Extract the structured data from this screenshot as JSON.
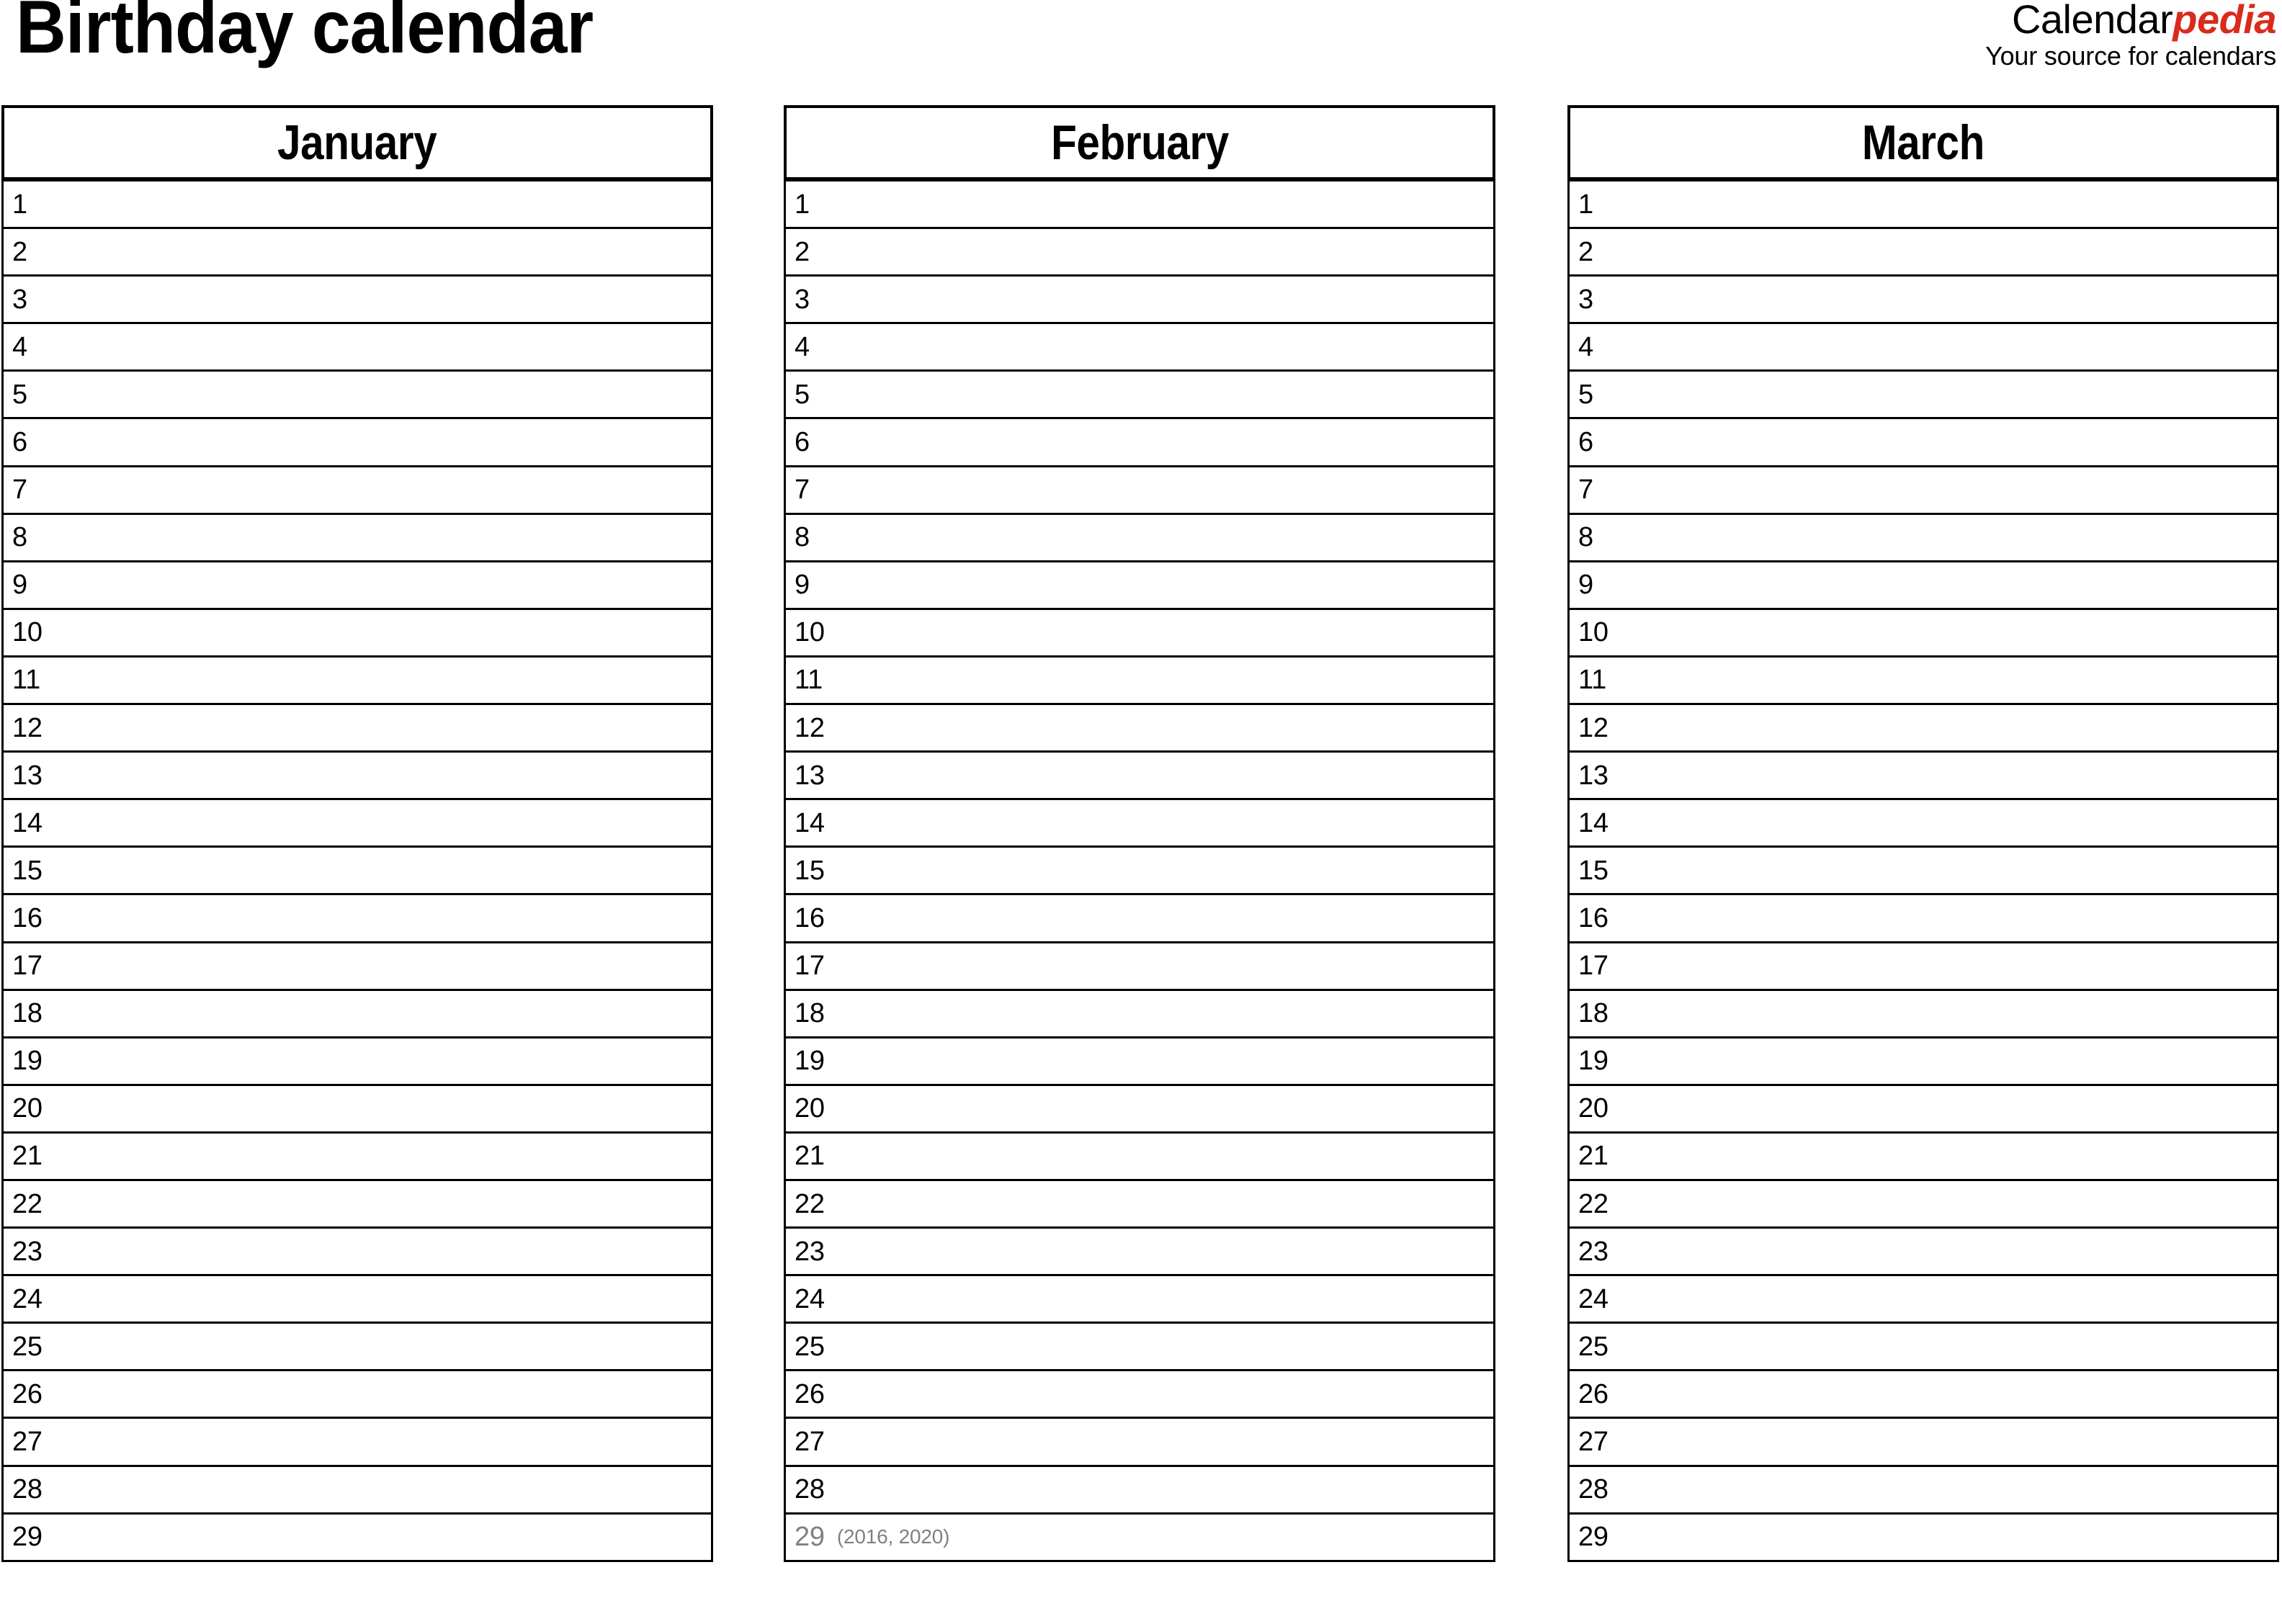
{
  "document": {
    "title": "Birthday calendar"
  },
  "brand": {
    "word1": "Calendar",
    "word2": "pedia",
    "tagline": "Your source for calendars",
    "accent_color": "#D92B1C"
  },
  "colors": {
    "border": "#000000",
    "text": "#000000",
    "muted": "#808080",
    "background": "#ffffff"
  },
  "months": [
    {
      "name": "January",
      "days": [
        {
          "num": "1"
        },
        {
          "num": "2"
        },
        {
          "num": "3"
        },
        {
          "num": "4"
        },
        {
          "num": "5"
        },
        {
          "num": "6"
        },
        {
          "num": "7"
        },
        {
          "num": "8"
        },
        {
          "num": "9"
        },
        {
          "num": "10"
        },
        {
          "num": "11"
        },
        {
          "num": "12"
        },
        {
          "num": "13"
        },
        {
          "num": "14"
        },
        {
          "num": "15"
        },
        {
          "num": "16"
        },
        {
          "num": "17"
        },
        {
          "num": "18"
        },
        {
          "num": "19"
        },
        {
          "num": "20"
        },
        {
          "num": "21"
        },
        {
          "num": "22"
        },
        {
          "num": "23"
        },
        {
          "num": "24"
        },
        {
          "num": "25"
        },
        {
          "num": "26"
        },
        {
          "num": "27"
        },
        {
          "num": "28"
        },
        {
          "num": "29"
        }
      ]
    },
    {
      "name": "February",
      "days": [
        {
          "num": "1"
        },
        {
          "num": "2"
        },
        {
          "num": "3"
        },
        {
          "num": "4"
        },
        {
          "num": "5"
        },
        {
          "num": "6"
        },
        {
          "num": "7"
        },
        {
          "num": "8"
        },
        {
          "num": "9"
        },
        {
          "num": "10"
        },
        {
          "num": "11"
        },
        {
          "num": "12"
        },
        {
          "num": "13"
        },
        {
          "num": "14"
        },
        {
          "num": "15"
        },
        {
          "num": "16"
        },
        {
          "num": "17"
        },
        {
          "num": "18"
        },
        {
          "num": "19"
        },
        {
          "num": "20"
        },
        {
          "num": "21"
        },
        {
          "num": "22"
        },
        {
          "num": "23"
        },
        {
          "num": "24"
        },
        {
          "num": "25"
        },
        {
          "num": "26"
        },
        {
          "num": "27"
        },
        {
          "num": "28"
        },
        {
          "num": "29",
          "note": "(2016, 2020)",
          "extra": true
        }
      ]
    },
    {
      "name": "March",
      "days": [
        {
          "num": "1"
        },
        {
          "num": "2"
        },
        {
          "num": "3"
        },
        {
          "num": "4"
        },
        {
          "num": "5"
        },
        {
          "num": "6"
        },
        {
          "num": "7"
        },
        {
          "num": "8"
        },
        {
          "num": "9"
        },
        {
          "num": "10"
        },
        {
          "num": "11"
        },
        {
          "num": "12"
        },
        {
          "num": "13"
        },
        {
          "num": "14"
        },
        {
          "num": "15"
        },
        {
          "num": "16"
        },
        {
          "num": "17"
        },
        {
          "num": "18"
        },
        {
          "num": "19"
        },
        {
          "num": "20"
        },
        {
          "num": "21"
        },
        {
          "num": "22"
        },
        {
          "num": "23"
        },
        {
          "num": "24"
        },
        {
          "num": "25"
        },
        {
          "num": "26"
        },
        {
          "num": "27"
        },
        {
          "num": "28"
        },
        {
          "num": "29"
        }
      ]
    }
  ]
}
